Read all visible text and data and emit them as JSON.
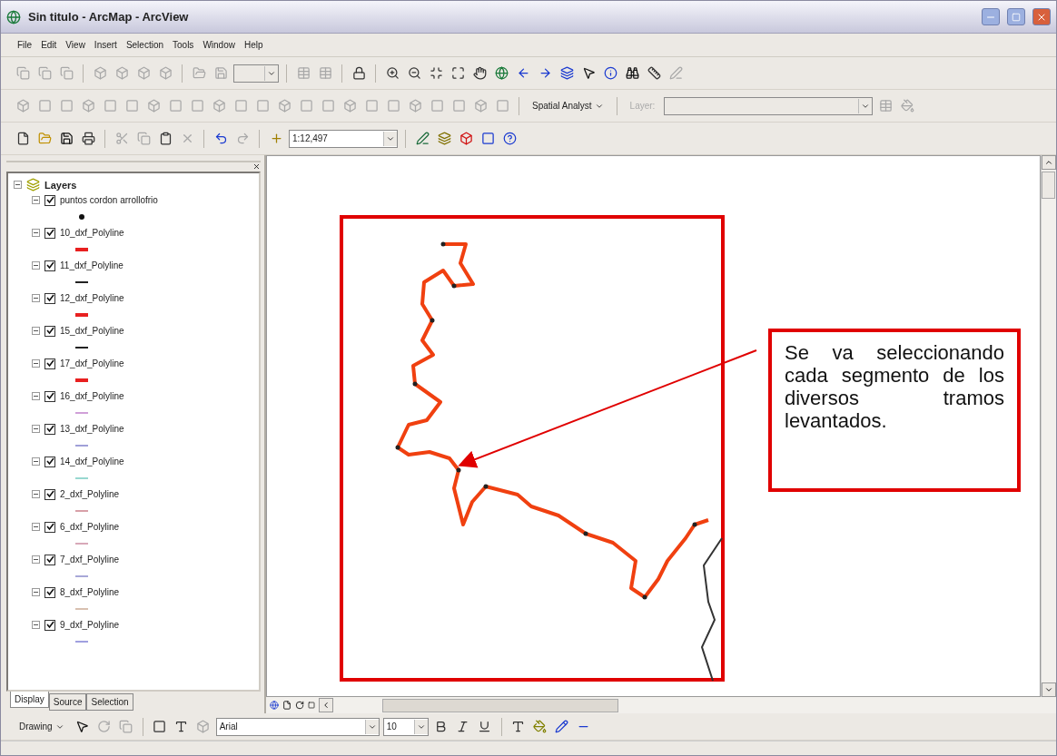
{
  "window": {
    "title": "Sin titulo - ArcMap - ArcView"
  },
  "menu": [
    "File",
    "Edit",
    "View",
    "Insert",
    "Selection",
    "Tools",
    "Window",
    "Help"
  ],
  "toolbars": {
    "spatial_analyst": "Spatial Analyst",
    "layer_label": "Layer:",
    "scale": "1:12,497"
  },
  "toc": {
    "root": "Layers",
    "layers": [
      {
        "name": "puntos cordon arrollofrio",
        "checked": true,
        "expanded": true,
        "kind": "point",
        "color": "#111111"
      },
      {
        "name": "10_dxf_Polyline",
        "checked": true,
        "expanded": true,
        "kind": "wide_line",
        "color": "#e82020"
      },
      {
        "name": "11_dxf_Polyline",
        "checked": true,
        "expanded": true,
        "kind": "line",
        "color": "#222222"
      },
      {
        "name": "12_dxf_Polyline",
        "checked": true,
        "expanded": true,
        "kind": "wide_line",
        "color": "#e82020"
      },
      {
        "name": "15_dxf_Polyline",
        "checked": true,
        "expanded": true,
        "kind": "line",
        "color": "#222222"
      },
      {
        "name": "17_dxf_Polyline",
        "checked": true,
        "expanded": true,
        "kind": "wide_line",
        "color": "#e82020"
      },
      {
        "name": "16_dxf_Polyline",
        "checked": true,
        "expanded": true,
        "kind": "line",
        "color": "#d0a0d8"
      },
      {
        "name": "13_dxf_Polyline",
        "checked": true,
        "expanded": true,
        "kind": "line",
        "color": "#a0a0d8"
      },
      {
        "name": "14_dxf_Polyline",
        "checked": true,
        "expanded": true,
        "kind": "line",
        "color": "#98d8d0"
      },
      {
        "name": "2_dxf_Polyline",
        "checked": true,
        "expanded": true,
        "kind": "line",
        "color": "#d8a0a8"
      },
      {
        "name": "6_dxf_Polyline",
        "checked": true,
        "expanded": true,
        "kind": "line",
        "color": "#d8a8b8"
      },
      {
        "name": "7_dxf_Polyline",
        "checked": true,
        "expanded": true,
        "kind": "line",
        "color": "#a8a8d8"
      },
      {
        "name": "8_dxf_Polyline",
        "checked": true,
        "expanded": true,
        "kind": "line",
        "color": "#d8c0b0"
      },
      {
        "name": "9_dxf_Polyline",
        "checked": true,
        "expanded": true,
        "kind": "line",
        "color": "#a0a0e0"
      }
    ]
  },
  "toc_tabs": [
    {
      "label": "Display",
      "selected": true
    },
    {
      "label": "Source",
      "selected": false
    },
    {
      "label": "Selection",
      "selected": false
    }
  ],
  "callout": "Se va seleccionando cada segmento de los diversos tramos levantados.",
  "drawing_toolbar": {
    "menu": "Drawing",
    "font": "Arial",
    "size": "10"
  }
}
